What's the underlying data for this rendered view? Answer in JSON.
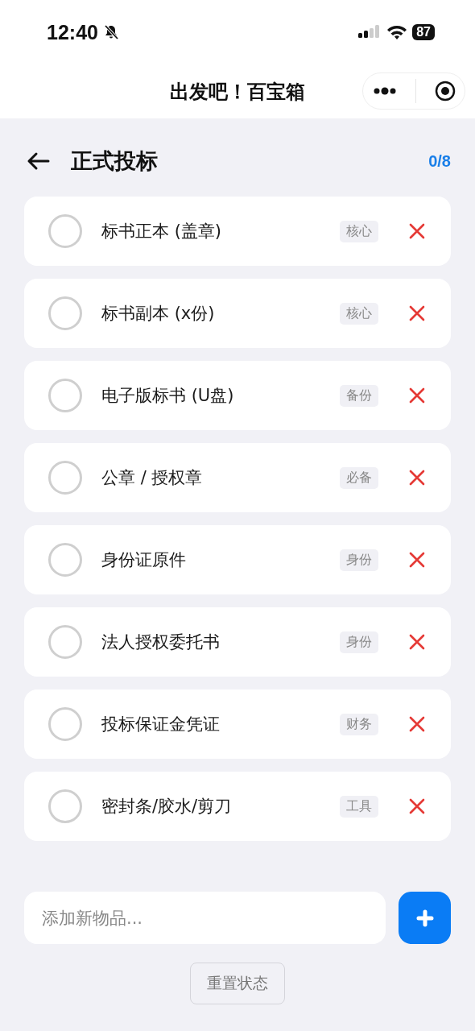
{
  "status_bar": {
    "time": "12:40",
    "battery": "87"
  },
  "nav": {
    "title": "出发吧！百宝箱"
  },
  "header": {
    "title": "正式投标",
    "progress": "0/8"
  },
  "items": [
    {
      "name": "标书正本 (盖章)",
      "tag": "核心",
      "checked": false
    },
    {
      "name": "标书副本 (x份)",
      "tag": "核心",
      "checked": false
    },
    {
      "name": "电子版标书 (U盘)",
      "tag": "备份",
      "checked": false
    },
    {
      "name": "公章 / 授权章",
      "tag": "必备",
      "checked": false
    },
    {
      "name": "身份证原件",
      "tag": "身份",
      "checked": false
    },
    {
      "name": "法人授权委托书",
      "tag": "身份",
      "checked": false
    },
    {
      "name": "投标保证金凭证",
      "tag": "财务",
      "checked": false
    },
    {
      "name": "密封条/胶水/剪刀",
      "tag": "工具",
      "checked": false
    }
  ],
  "add": {
    "placeholder": "添加新物品..."
  },
  "reset_button": "重置状态"
}
